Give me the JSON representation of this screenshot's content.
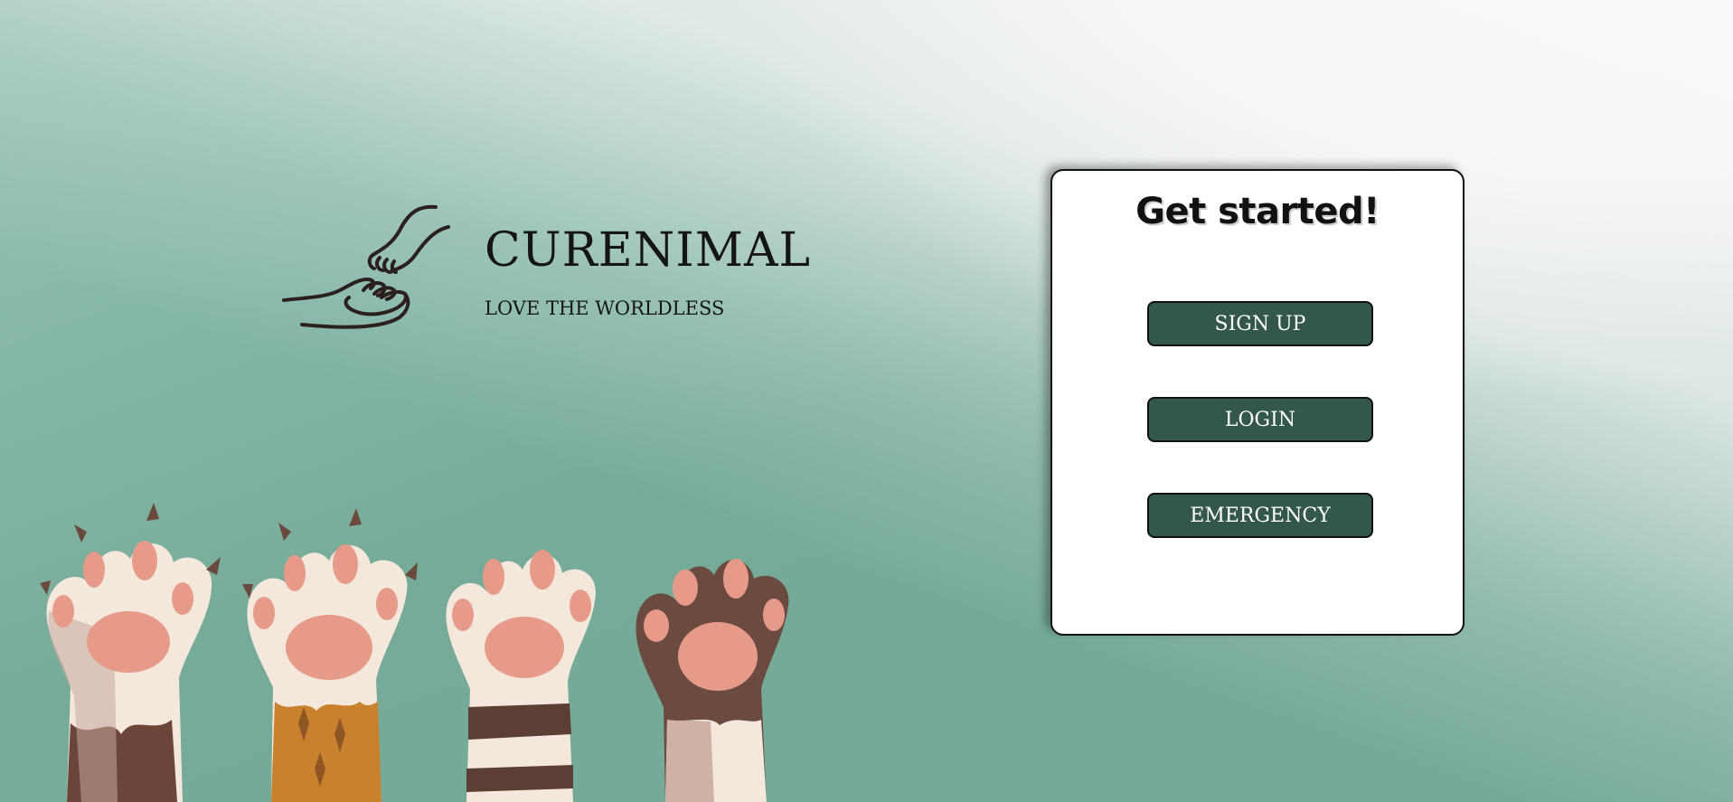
{
  "brand": {
    "name": "CURENIMAL",
    "tagline": "LOVE THE WORLDLESS"
  },
  "card": {
    "title": "Get started!",
    "buttons": {
      "signup": "SIGN UP",
      "login": "LOGIN",
      "emergency": "EMERGENCY"
    }
  },
  "colors": {
    "background": "#74aa98",
    "button": "#33584b",
    "card": "#ffffff",
    "text": "#151515"
  },
  "icons": {
    "logo": "hand-holding-paw-icon",
    "illustration": "raised-cat-paws-illustration"
  }
}
